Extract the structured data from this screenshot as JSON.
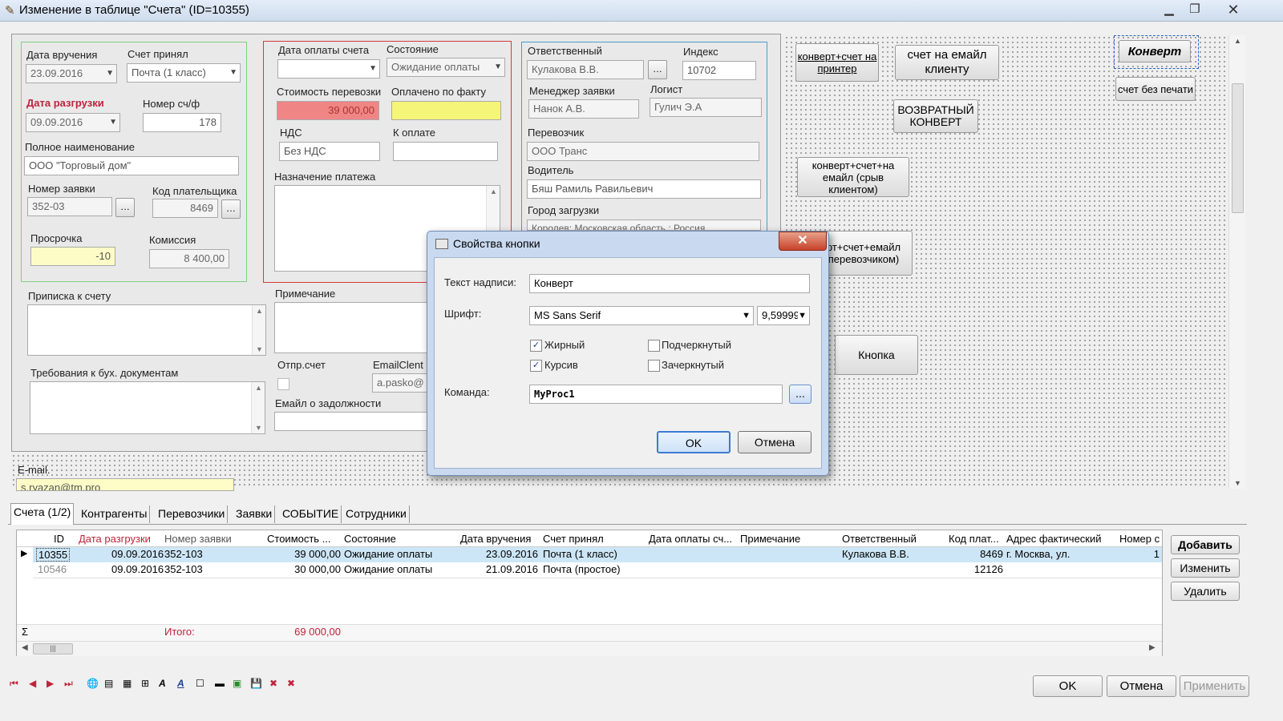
{
  "window": {
    "title": "Изменение в таблице \"Счета\" (ID=10355)"
  },
  "form": {
    "date_delivery_label": "Дата вручения",
    "date_delivery": "23.09.2016",
    "account_accepted_label": "Счет принял",
    "account_accepted": "Почта (1 класс)",
    "unload_date_label": "Дата разгрузки",
    "unload_date": "09.09.2016",
    "invoice_no_label": "Номер сч/ф",
    "invoice_no": "178",
    "fullname_label": "Полное наименование",
    "fullname": "ООО \"Торговый дом\"",
    "request_no_label": "Номер заявки",
    "request_no": "352-03",
    "payer_code_label": "Код плательщика",
    "payer_code": "8469",
    "overdue_label": "Просрочка",
    "overdue": "-10",
    "commission_label": "Комиссия",
    "commission": "8 400,00",
    "pay_date_label": "Дата оплаты счета",
    "pay_date": "",
    "state_label": "Состояние",
    "state": "Ожидание оплаты",
    "cost_label": "Стоимость перевозки",
    "cost": "39 000,00",
    "paid_label": "Оплачено по факту",
    "paid": "",
    "vat_label": "НДС",
    "vat": "Без НДС",
    "to_pay_label": "К оплате",
    "to_pay": "",
    "purpose_label": "Назначение платежа",
    "responsible_label": "Ответственный",
    "responsible": "Кулакова В.В.",
    "index_label": "Индекс",
    "index": "10702",
    "manager_label": "Менеджер заявки",
    "manager": "Нанок А.В.",
    "logist_label": "Логист",
    "logist": "Гулич Э.А",
    "carrier_label": "Перевозчик",
    "carrier": "ООО Транс",
    "driver_label": "Водитель",
    "driver": "Бяш Рамиль Равильевич",
    "city_label": "Город загрузки",
    "city": "Королев; Московская область ; Россия",
    "note_account_label": "Приписка к счету",
    "accounting_req_label": "Требования к бух. документам",
    "note_label": "Примечание",
    "sent_label": "Отпр.счет",
    "emailclient_label": "EmailClent",
    "emailclient": "a.pasko@",
    "debt_email_label": "Емайл о задолжности",
    "email_label": "E-mail.",
    "email": "s.ryazan@tm.pro"
  },
  "designer_buttons": {
    "b1": "конверт+счет на принтер",
    "b2": "счет на емайл клиенту",
    "b3": "Конверт",
    "b4": "счет без печати",
    "b5": "ВОЗВРАТНЫЙ КОНВЕРТ",
    "b6": "конверт+счет+на емайл (срыв клиентом)",
    "b7": "рт+счет+емайл перевозчиком)",
    "b8": "Кнопка"
  },
  "dialog": {
    "title": "Свойства кнопки",
    "caption_label": "Текст надписи:",
    "caption_value": "Конверт",
    "font_label": "Шрифт:",
    "font_value": "MS Sans Serif",
    "size_value": "9,59999",
    "bold_label": "Жирный",
    "bold": true,
    "underline_label": "Подчеркнутый",
    "underline": false,
    "italic_label": "Курсив",
    "italic": true,
    "strike_label": "Зачеркнутый",
    "strike": false,
    "command_label": "Команда:",
    "command_value": "MyProc1",
    "browse_label": "...",
    "ok_label": "OK",
    "cancel_label": "Отмена"
  },
  "tabs": [
    "Счета (1/2)",
    "Контрагенты",
    "Перевозчики",
    "Заявки",
    "СОБЫТИЕ",
    "Сотрудники"
  ],
  "grid": {
    "headers": [
      "ID",
      "Дата разгрузки",
      "Номер заявки",
      "Стоимость ...",
      "Состояние",
      "Дата вручения",
      "Счет принял",
      "Дата оплаты сч...",
      "Примечание",
      "Ответственный",
      "Код плат...",
      "Адрес фактический",
      "Номер с"
    ],
    "rows": [
      [
        "10355",
        "09.09.2016",
        "352-103",
        "39 000,00",
        "Ожидание оплаты",
        "23.09.2016",
        "Почта (1 класс)",
        "",
        "",
        "Кулакова В.В.",
        "8469",
        "г. Москва, ул.",
        "1"
      ],
      [
        "10546",
        "09.09.2016",
        "352-103",
        "30 000,00",
        "Ожидание оплаты",
        "21.09.2016",
        "Почта (простое)",
        "",
        "",
        "",
        "12126",
        "",
        ""
      ]
    ],
    "total_symbol": "Σ",
    "total_label": "Итого:",
    "total_value": "69 000,00"
  },
  "side_buttons": {
    "add": "Добавить",
    "edit": "Изменить",
    "delete": "Удалить"
  },
  "footer": {
    "ok": "OK",
    "cancel": "Отмена",
    "apply": "Применить"
  }
}
